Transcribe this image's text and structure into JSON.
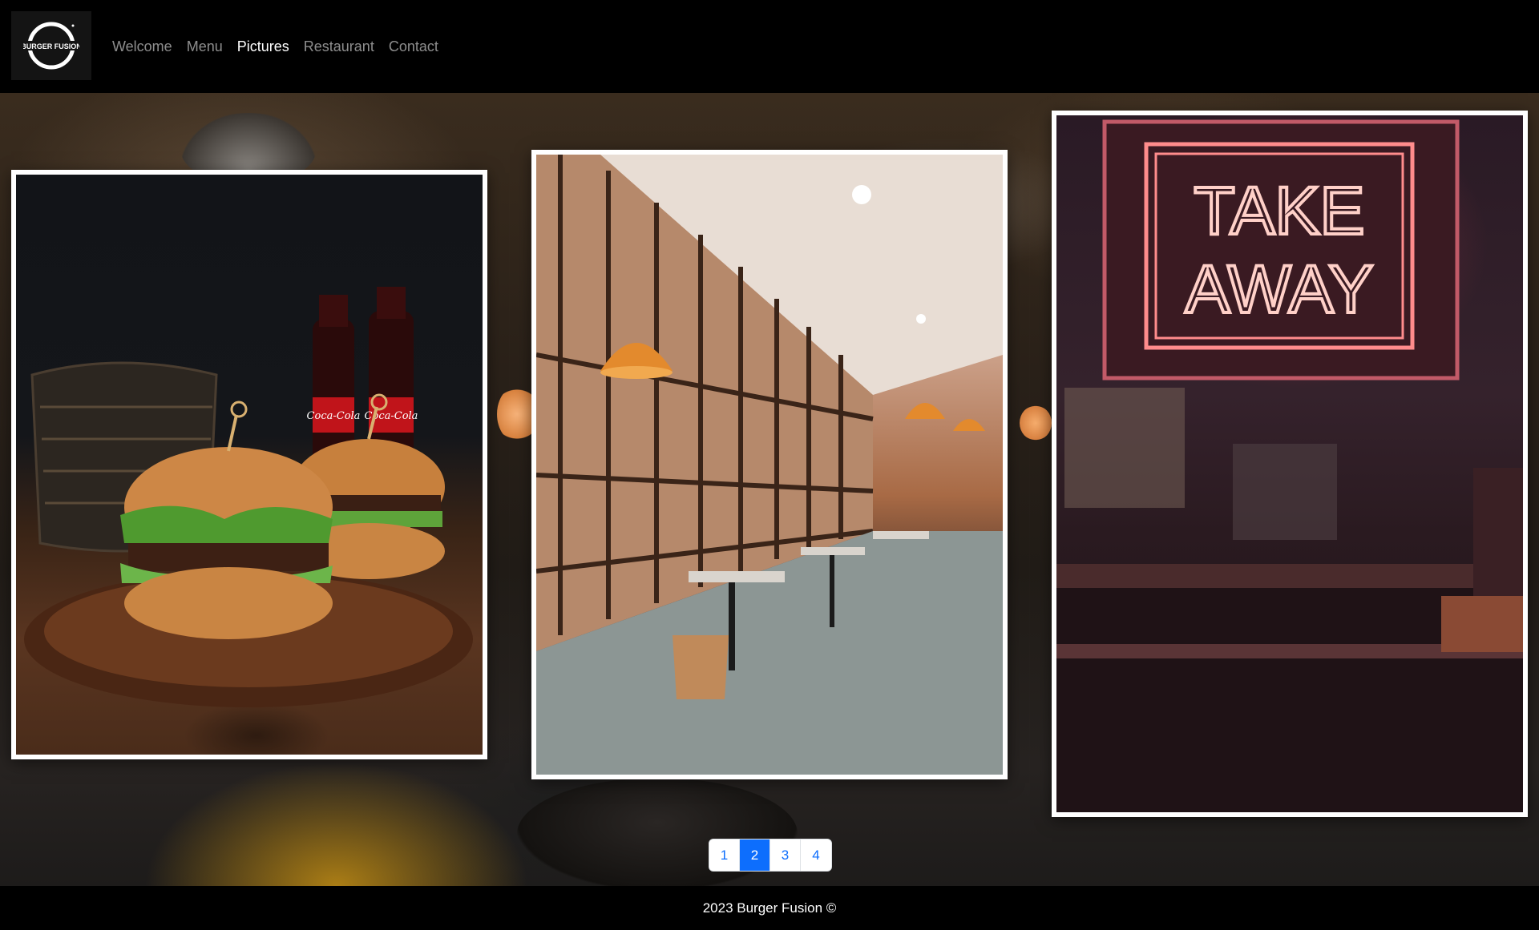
{
  "brand": {
    "logo_text": "BURGER FUSION"
  },
  "nav": {
    "items": [
      {
        "label": "Welcome",
        "active": false
      },
      {
        "label": "Menu",
        "active": false
      },
      {
        "label": "Pictures",
        "active": true
      },
      {
        "label": "Restaurant",
        "active": false
      },
      {
        "label": "Contact",
        "active": false
      }
    ]
  },
  "gallery": {
    "photos": [
      {
        "subject": "burgers-and-cola"
      },
      {
        "subject": "restaurant-interior"
      },
      {
        "subject": "take-away-neon-sign",
        "sign_text": [
          "TAKE",
          "AWAY"
        ]
      }
    ]
  },
  "pagination": {
    "pages": [
      "1",
      "2",
      "3",
      "4"
    ],
    "active_index": 1,
    "active_color": "#0d6efd"
  },
  "footer": {
    "text": "2023 Burger Fusion ©"
  }
}
